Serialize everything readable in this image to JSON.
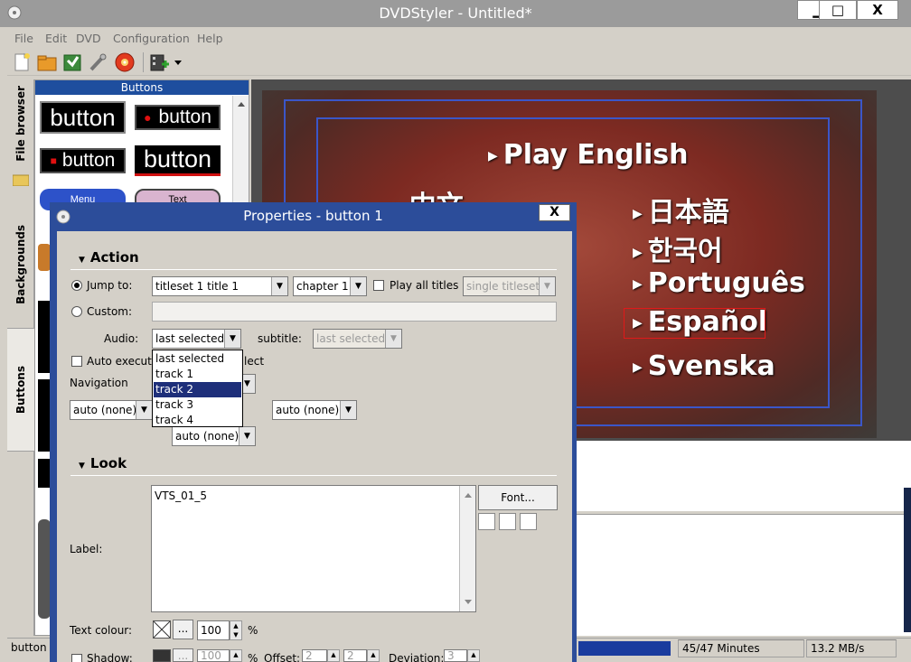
{
  "window": {
    "title": "DVDStyler - Untitled*",
    "minimize": "▁",
    "maximize": "□",
    "close": "X"
  },
  "menubar": [
    "File",
    "Edit",
    "DVD",
    "Configuration",
    "Help"
  ],
  "toolbar": [
    "new-icon",
    "open-icon",
    "save-icon",
    "settings-icon",
    "burn-icon",
    "add-file-icon",
    "dropdown-icon"
  ],
  "vtabs": [
    "File browser",
    "Backgrounds",
    "Buttons"
  ],
  "palette": {
    "header": "Buttons",
    "items": [
      "button",
      "button",
      "button",
      "button",
      "Menu",
      "Text"
    ]
  },
  "preview": {
    "entries": [
      "Play English",
      "中文",
      "日本語",
      "한국어",
      "Português",
      "Español",
      "Svenska"
    ],
    "selected": "Español"
  },
  "status": {
    "left": "button",
    "duration": "45/47 Minutes",
    "rate": "13.2 MB/s"
  },
  "dialog": {
    "title": "Properties - button 1",
    "close": "X",
    "action_header": "Action",
    "jump_to_label": "Jump to:",
    "jump_to_value": "titleset 1 title 1",
    "chapter_value": "chapter 1",
    "play_all_titles": "Play all titles",
    "titleset_value": "single titleset",
    "custom_label": "Custom:",
    "audio_label": "Audio:",
    "audio_value": "last selected",
    "subtitle_label": "subtitle:",
    "subtitle_value": "last selected",
    "auto_execute_label": "Auto execute",
    "auto_execute_tail": "lect",
    "navigation_label": "Navigation",
    "nav_left": "auto (none)",
    "nav_right": "auto (none)",
    "nav_down": "auto (none)",
    "audio_options": [
      "last selected",
      "track 1",
      "track 2",
      "track 3",
      "track 4"
    ],
    "audio_highlighted": "track 2",
    "look_header": "Look",
    "label_label": "Label:",
    "label_value": "VTS_01_5",
    "font_button": "Font...",
    "text_colour_label": "Text colour:",
    "ellipsis": "...",
    "opacity": "100",
    "percent": "%",
    "shadow_label": "Shadow:",
    "shadow_opacity": "100",
    "offset_label": "Offset:",
    "offset_x": "2",
    "offset_y": "2",
    "deviation_label": "Deviation:",
    "deviation_value": "3"
  }
}
